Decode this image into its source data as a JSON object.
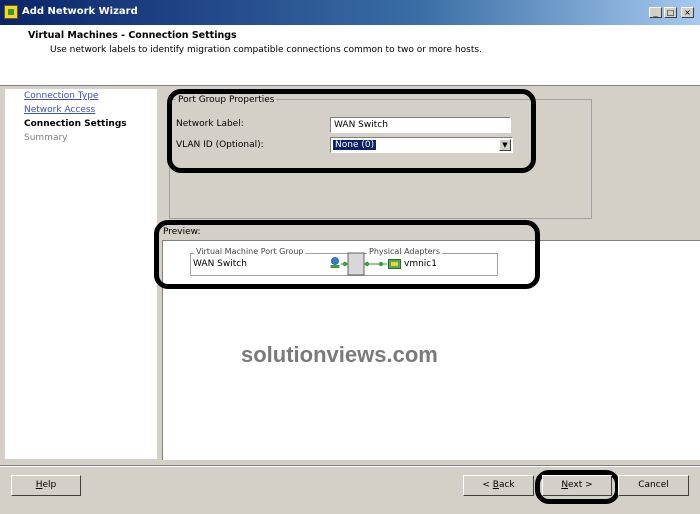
{
  "window": {
    "title": "Add Network Wizard"
  },
  "header": {
    "title": "Virtual Machines - Connection Settings",
    "subtitle": "Use network labels to identify migration compatible connections common to two or more hosts."
  },
  "nav": {
    "items": [
      {
        "label": "Connection Type",
        "state": "link"
      },
      {
        "label": "Network Access",
        "state": "link"
      },
      {
        "label": "Connection Settings",
        "state": "current"
      },
      {
        "label": "Summary",
        "state": "disabled"
      }
    ]
  },
  "port_group": {
    "legend": "Port Group Properties",
    "network_label": {
      "label": "Network Label:",
      "value": "WAN Switch"
    },
    "vlan_id": {
      "label": "VLAN ID (Optional):",
      "value": "None (0)"
    }
  },
  "preview": {
    "label": "Preview:",
    "vm_port_group_legend": "Virtual Machine Port Group",
    "vm_port_group_name": "WAN Switch",
    "physical_adapters_legend": "Physical Adapters",
    "adapter_name": "vmnic1"
  },
  "watermark": "solutionviews.com",
  "buttons": {
    "help": {
      "accel": "H",
      "rest": "elp"
    },
    "back": {
      "prefix": "< ",
      "accel": "B",
      "rest": "ack"
    },
    "next": {
      "accel": "N",
      "rest": "ext >"
    },
    "cancel": "Cancel"
  },
  "colors": {
    "link": "#3c4fbf",
    "selection": "#0a246a",
    "annotation": "#000000"
  }
}
